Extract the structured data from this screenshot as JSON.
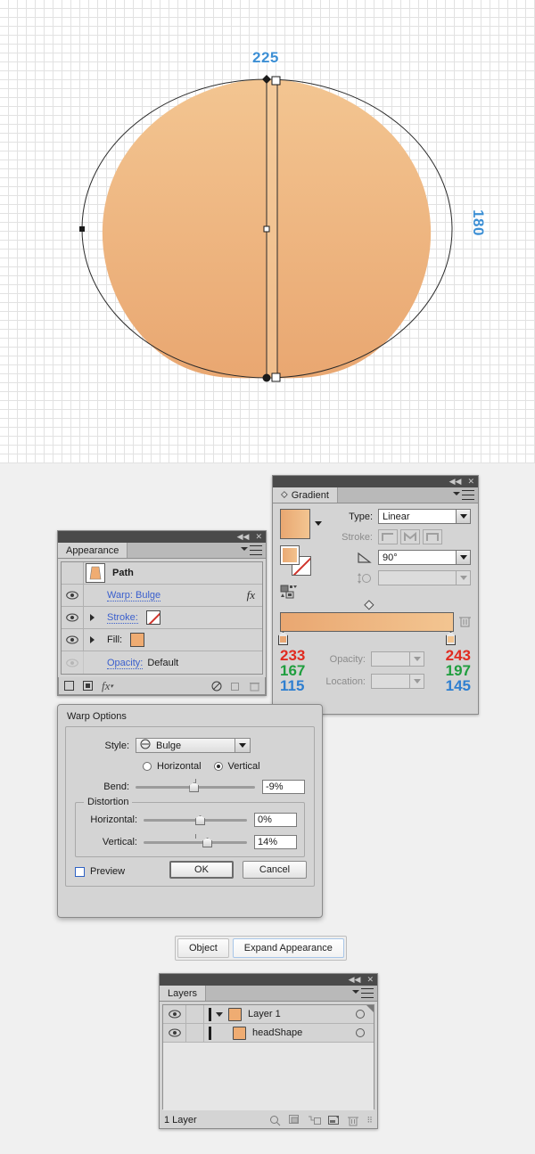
{
  "canvas": {
    "width_label": "225",
    "height_label": "180",
    "shape_name": "warped-head-ellipse",
    "fill_gradient_start": "#e9a771",
    "fill_gradient_end": "#f3c591",
    "outline_color": "#1a1a1a",
    "selection_color": "#3d8fd4",
    "grid_color": "#e2e2e2"
  },
  "appearance": {
    "tab": "Appearance",
    "rows": [
      {
        "label": "Path",
        "type": "header"
      },
      {
        "label": "Warp: Bulge",
        "type": "effect",
        "fx": "fx"
      },
      {
        "label": "Stroke:",
        "type": "stroke",
        "value": "None"
      },
      {
        "label": "Fill:",
        "type": "fill",
        "value": "#efac72"
      },
      {
        "label": "Opacity:",
        "type": "opacity",
        "value": "Default"
      }
    ],
    "footer_icons": [
      "add-new-stroke-icon",
      "add-new-fill-icon",
      "add-new-effect-icon",
      "clear-appearance-icon",
      "duplicate-item-icon",
      "delete-item-icon"
    ]
  },
  "gradient": {
    "tab": "Gradient",
    "type_label": "Type:",
    "type_value": "Linear",
    "stroke_label": "Stroke:",
    "angle_label": "angle-icon",
    "angle_value": "90°",
    "aspect_label": "aspect-ratio-icon",
    "aspect_value": "",
    "opacity_label": "Opacity:",
    "opacity_value": "",
    "location_label": "Location:",
    "location_value": "",
    "stop_left": {
      "r": "233",
      "g": "167",
      "b": "115",
      "color": "#e9a773"
    },
    "stop_right": {
      "r": "243",
      "g": "197",
      "b": "145",
      "color": "#f3c591"
    }
  },
  "warp_dialog": {
    "title": "Warp Options",
    "style_label": "Style:",
    "style_value": "Bulge",
    "orientation": {
      "horizontal": "Horizontal",
      "vertical": "Vertical",
      "selected": "Vertical"
    },
    "bend_label": "Bend:",
    "bend_value": "-9%",
    "bend_pct": 45,
    "distortion_title": "Distortion",
    "horizontal_label": "Horizontal:",
    "horizontal_value": "0%",
    "horizontal_pct": 50,
    "vertical_label": "Vertical:",
    "vertical_value": "14%",
    "vertical_pct": 57,
    "preview_label": "Preview",
    "ok_label": "OK",
    "cancel_label": "Cancel"
  },
  "expand_bar": {
    "object_label": "Object",
    "expand_label": "Expand Appearance"
  },
  "layers": {
    "tab": "Layers",
    "rows": [
      {
        "name": "Layer 1",
        "thumb": "#efac72",
        "indent": 0,
        "expanded": true
      },
      {
        "name": "headShape",
        "thumb": "#efac72",
        "indent": 1,
        "expanded": false
      }
    ],
    "status": "1 Layer",
    "footer_icons": [
      "locate-object-icon",
      "make-clipping-mask-icon",
      "create-new-sublayer-icon",
      "create-new-layer-icon",
      "delete-selection-icon"
    ]
  }
}
